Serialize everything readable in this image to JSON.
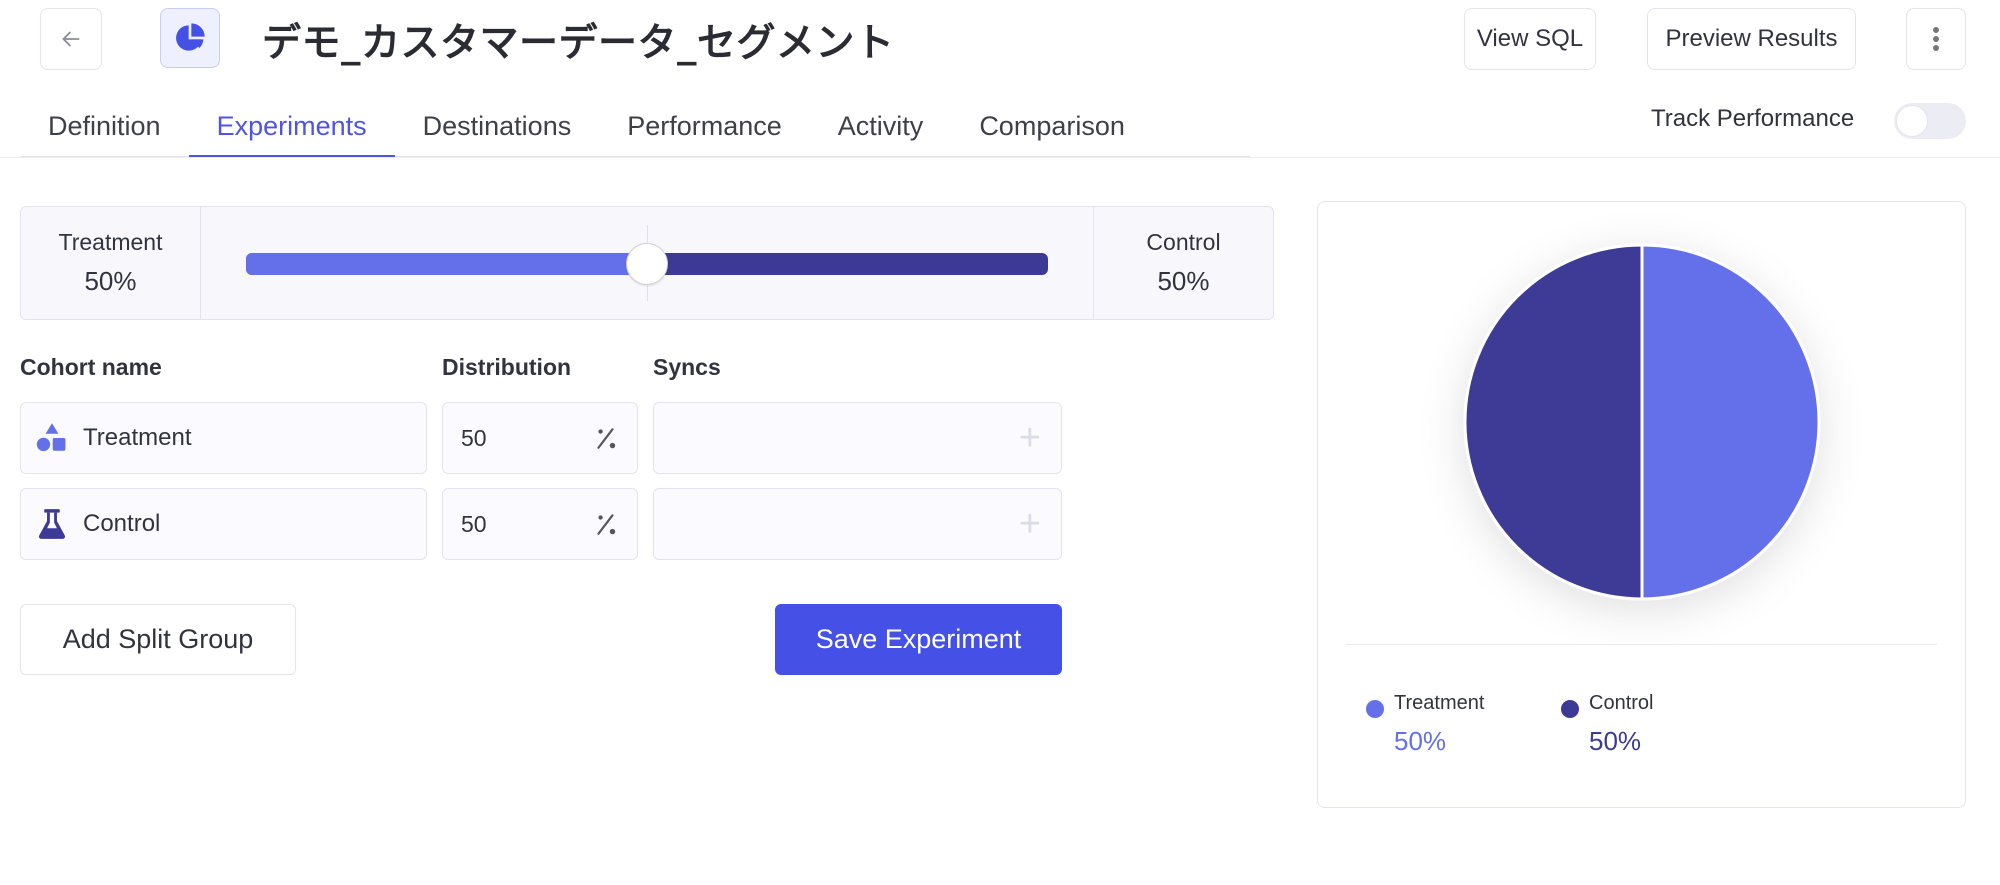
{
  "header": {
    "title": "デモ_カスタマーデータ_セグメント",
    "back_icon": "arrow-left-icon",
    "segment_icon": "pie-chart-icon",
    "buttons": {
      "view_sql": "View SQL",
      "preview_results": "Preview Results",
      "more_icon": "more-vertical-icon"
    }
  },
  "tabs": [
    {
      "label": "Definition",
      "active": false
    },
    {
      "label": "Experiments",
      "active": true
    },
    {
      "label": "Destinations",
      "active": false
    },
    {
      "label": "Performance",
      "active": false
    },
    {
      "label": "Activity",
      "active": false
    },
    {
      "label": "Comparison",
      "active": false
    }
  ],
  "track_performance": {
    "label": "Track Performance",
    "enabled": false
  },
  "split": {
    "left": {
      "label": "Treatment",
      "value": "50%"
    },
    "right": {
      "label": "Control",
      "value": "50%"
    },
    "treatment_fraction": 0.5
  },
  "columns": {
    "cohort_name": "Cohort name",
    "distribution": "Distribution",
    "syncs": "Syncs"
  },
  "cohorts": [
    {
      "name": "Treatment",
      "icon": "shapes-icon",
      "distribution": "50",
      "unit_icon": "percent-icon",
      "syncs_add_icon": "plus-icon"
    },
    {
      "name": "Control",
      "icon": "flask-icon",
      "distribution": "50",
      "unit_icon": "percent-icon",
      "syncs_add_icon": "plus-icon"
    }
  ],
  "actions": {
    "add_split_group": "Add Split Group",
    "save_experiment": "Save Experiment"
  },
  "colors": {
    "treatment": "#6470ea",
    "control": "#3d3a96",
    "accent": "#4550e6"
  },
  "chart_data": {
    "type": "pie",
    "title": "",
    "categories": [
      "Treatment",
      "Control"
    ],
    "values": [
      50,
      50
    ],
    "colors": [
      "#6470ea",
      "#3d3a96"
    ],
    "legend": [
      {
        "label": "Treatment",
        "value": "50%"
      },
      {
        "label": "Control",
        "value": "50%"
      }
    ],
    "legend_position": "bottom-left"
  }
}
